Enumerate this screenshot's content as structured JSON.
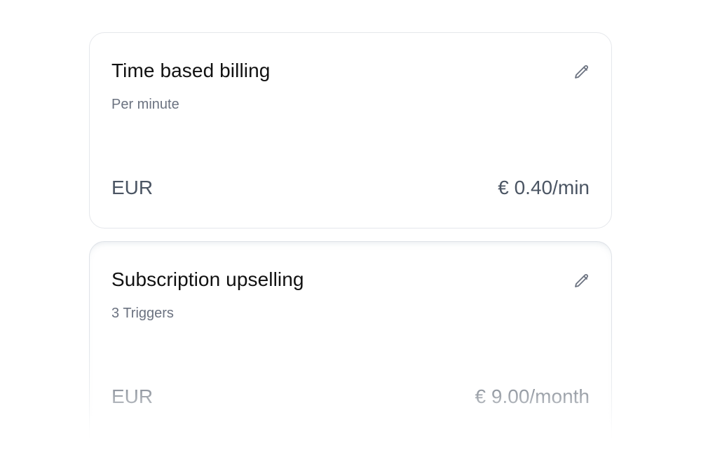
{
  "cards": [
    {
      "title": "Time based billing",
      "subtitle": "Per minute",
      "currency": "EUR",
      "price": "€ 0.40/min",
      "edit_icon": "pencil-icon"
    },
    {
      "title": "Subscription upselling",
      "subtitle": "3 Triggers",
      "currency": "EUR",
      "price": "€ 9.00/month",
      "edit_icon": "pencil-icon"
    }
  ],
  "colors": {
    "title": "#111111",
    "subtitle": "#6b7280",
    "value": "#4b5563",
    "border": "#e5e7eb",
    "icon": "#6b7280"
  }
}
